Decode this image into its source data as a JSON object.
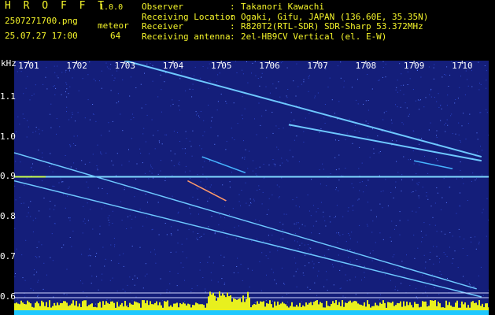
{
  "header": {
    "app_name": "H R O F F T",
    "version": "1.0.0",
    "filename": "2507271700.png",
    "meteor_label": "meteor",
    "datetime": "25.07.27 17:00",
    "meteor_count": "64",
    "info": [
      {
        "key": "Observer",
        "value": "Takanori Kawachi"
      },
      {
        "key": "Receiving Location",
        "value": "Ogaki, Gifu, JAPAN (136.60E, 35.35N)"
      },
      {
        "key": "Receiver",
        "value": "R820T2(RTL-SDR) SDR-Sharp 53.372MHz"
      },
      {
        "key": "Receiving antenna",
        "value": "2el-HB9CV Vertical (el. E-W)"
      }
    ]
  },
  "colors": {
    "plot_background": "#141e7a",
    "header_text": "#f5f52a",
    "tick_text": "#ffffff",
    "bar_fill": "#e8f01e",
    "bar_base": "#1ec8ff"
  },
  "chart_data": {
    "type": "heatmap",
    "title": "",
    "xlabel": "",
    "ylabel": "kHz",
    "x_ticks": [
      "1701",
      "1702",
      "1703",
      "1704",
      "1705",
      "1706",
      "1707",
      "1708",
      "1709",
      "1710"
    ],
    "x_range": [
      1700.7,
      1710.55
    ],
    "y_ticks": [
      "1.1",
      "1.0",
      "0.9",
      "0.8",
      "0.7",
      "0.6"
    ],
    "y_range": [
      0.6,
      1.19
    ],
    "y_unit": "kHz",
    "carrier_khz": 0.9,
    "traces": [
      {
        "name_hidden": true,
        "x": [
          1703.0,
          1710.4
        ],
        "y": [
          1.19,
          0.95
        ]
      },
      {
        "name_hidden": true,
        "x": [
          1706.4,
          1710.4
        ],
        "y": [
          1.03,
          0.94
        ]
      },
      {
        "name_hidden": true,
        "x": [
          1700.7,
          1710.3
        ],
        "y": [
          0.96,
          0.62
        ]
      },
      {
        "name_hidden": true,
        "x": [
          1700.7,
          1710.4
        ],
        "y": [
          0.89,
          0.6
        ]
      },
      {
        "name_hidden": true,
        "x": [
          1704.3,
          1705.1
        ],
        "y": [
          0.89,
          0.84
        ]
      },
      {
        "name_hidden": true,
        "x": [
          1704.6,
          1705.5
        ],
        "y": [
          0.95,
          0.91
        ]
      },
      {
        "name_hidden": true,
        "x": [
          1709.0,
          1709.8
        ],
        "y": [
          0.94,
          0.92
        ]
      }
    ]
  }
}
